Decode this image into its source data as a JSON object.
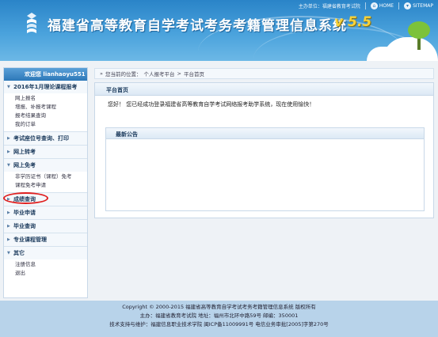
{
  "header": {
    "title": "福建省高等教育自学考试考务考籍管理信息系统",
    "version": "v 5.5",
    "sponsor": "主办单位：福建省教育考试院",
    "home_label": "HOME",
    "sitemap_label": "SITEMAP"
  },
  "sidebar": {
    "welcome": "欢迎您 lianhaoyu551",
    "groups": [
      {
        "label": "2016年1月理论课程报考",
        "expanded": true,
        "items": [
          "网上报名",
          "增报、补报考课程",
          "报考结果查询",
          "我的订单"
        ]
      },
      {
        "label": "考试座位号查询、打印",
        "expanded": false,
        "items": []
      },
      {
        "label": "网上转考",
        "expanded": false,
        "items": []
      },
      {
        "label": "网上免考",
        "expanded": true,
        "items": [
          "非学历证书（课程）免考",
          "课程免考申请"
        ]
      },
      {
        "label": "成绩查询",
        "expanded": false,
        "items": []
      },
      {
        "label": "毕业申请",
        "expanded": false,
        "items": []
      },
      {
        "label": "毕业查询",
        "expanded": false,
        "items": []
      },
      {
        "label": "专业课程管理",
        "expanded": false,
        "items": []
      },
      {
        "label": "其它",
        "expanded": true,
        "items": [
          "注册信息",
          "退出"
        ]
      }
    ]
  },
  "breadcrumb": {
    "prefix": "您当前的位置：",
    "path": [
      "个人报考平台",
      "平台首页"
    ]
  },
  "main": {
    "tab": "平台首页",
    "welcome_msg": "您好！ 您已经成功登录福建省高等教育自学考试网络报考助学系统，现在使用愉快！",
    "notice_title": "最新公告"
  },
  "footer": {
    "line1": "Copyright © 2000-2015 福建省高等教育自学考试考务考籍管理信息系统    版权所有",
    "line2": "主办：福建省教育考试院    地址：福州市北环中路59号    邮编：350001",
    "line3": "技术支持与维护：福建信息职业技术学院    闽ICP备11009991号    电信业务审批[2005]字第270号"
  },
  "colors": {
    "header_blue": "#2a84c8",
    "version_yellow": "#f7d23a",
    "highlight_red": "#e02020"
  }
}
